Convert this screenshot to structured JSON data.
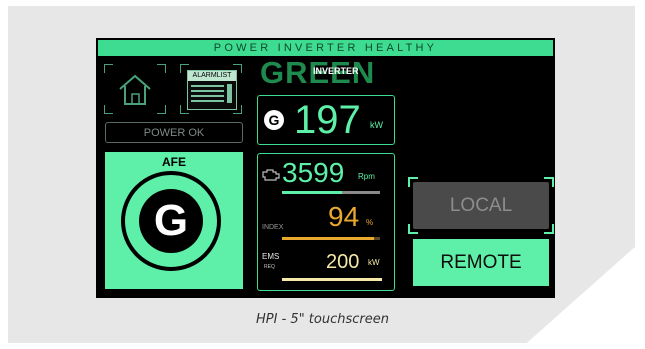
{
  "banner": {
    "text": "POWER INVERTER HEALTHY"
  },
  "nav": {
    "home_icon": "home-icon",
    "alarm_list_label": "ALARMLIST"
  },
  "power_status": "POWER OK",
  "afe": {
    "title": "AFE",
    "symbol": "G"
  },
  "inverter": {
    "status_word": "GREEN",
    "tag": "INVERTER"
  },
  "power": {
    "symbol": "G",
    "value": "197",
    "unit": "kW"
  },
  "speed": {
    "icon": "engine-icon",
    "value": "3599",
    "unit": "Rpm"
  },
  "index": {
    "label": "INDEX",
    "value": "94",
    "unit": "%"
  },
  "ems": {
    "label": "EMS",
    "sublabel": "REQ",
    "value": "200",
    "unit": "kW"
  },
  "mode": {
    "local_label": "LOCAL",
    "remote_label": "REMOTE",
    "active": "REMOTE"
  },
  "caption": "HPI - 5\" touchscreen",
  "colors": {
    "accent": "#5ef0a8",
    "banner": "#3ddc91",
    "status_word": "#1e8a4e",
    "index": "#e9a82e",
    "ems": "#f4e9a8",
    "local_bg": "#4a4a4a",
    "screen_bg": "#000000"
  }
}
